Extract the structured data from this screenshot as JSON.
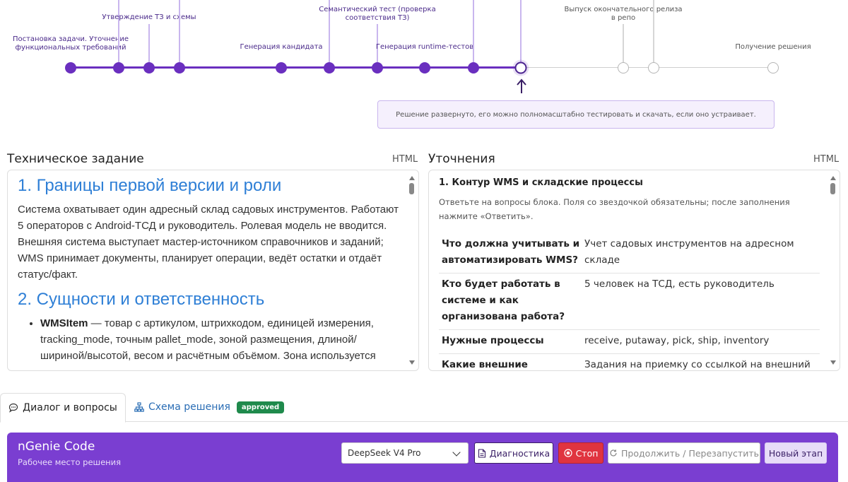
{
  "timeline": {
    "stages": [
      {
        "label": "Постановка задачи. Уточнение\nфункциональных требований",
        "status": "done"
      },
      {
        "label": "",
        "status": "done"
      },
      {
        "label": "Утверждение ТЗ и схемы",
        "status": "done"
      },
      {
        "label": "",
        "status": "done"
      },
      {
        "label": "Генерация кандидата",
        "status": "done"
      },
      {
        "label": "",
        "status": "done"
      },
      {
        "label": "Семантический тест (проверка\nсоответствия ТЗ)",
        "status": "done"
      },
      {
        "label": "Генерация runtime-тестов",
        "status": "done"
      },
      {
        "label": "",
        "status": "done"
      },
      {
        "label": "",
        "status": "current"
      },
      {
        "label": "Выпуск окончательного релиза\nв репо",
        "status": "todo"
      },
      {
        "label": "",
        "status": "todo"
      },
      {
        "label": "Получение решения",
        "status": "todo"
      }
    ],
    "current_info": "Решение развернуто, его можно полномасштабно тестировать и скачать, если оно устраивает."
  },
  "spec_panel": {
    "title": "Техническое задание",
    "mode": "HTML",
    "heading1": "1. Границы первой версии и роли",
    "paragraph1": "Система охватывает один адресный склад садовых инструментов. Работают 5 операторов с Android-ТСД и руководитель. Ролевая модель не вводится. Внешняя система выступает мастер-источником справочников и заданий; WMS принимает документы, планирует операции, ведёт остатки и отдаёт статус/факт.",
    "heading2": "2. Сущности и ответственность",
    "bullet1_term": "WMSItem",
    "bullet1_text": " — товар с артикулом, штрихкодом, единицей измерения, tracking_mode, точным pallet_mode, зоной размещения, длиной/шириной/высотой, весом и расчётным объёмом. Зона используется"
  },
  "clar_panel": {
    "title": "Уточнения",
    "mode": "HTML",
    "block_title": "1. Контур WMS и складские процессы",
    "hint": "Ответьте на вопросы блока. Поля со звездочкой обязательны; после заполнения нажмите «Ответить».",
    "rows": [
      {
        "q": "Что должна учитывать и автоматизировать WMS?",
        "a": "Учет садовых инструментов на адресном складе"
      },
      {
        "q": "Кто будет работать в системе и как организована работа?",
        "a": "5 человек на ТСД, есть руководитель"
      },
      {
        "q": "Нужные процессы",
        "a": "receive, putaway, pick, ship, inventory"
      },
      {
        "q": "Какие внешние",
        "a": "Задания на приемку со ссылкой на внешний"
      }
    ]
  },
  "tabs": {
    "dialog_icon": "speech-bubble-icon",
    "dialog_label": "Диалог и вопросы",
    "scheme_icon": "tree-diagram-icon",
    "scheme_label": "Схема решения",
    "scheme_badge": "approved"
  },
  "ngenie": {
    "title": "nGenie Code",
    "subtitle": "Рабочее место решения",
    "model": "DeepSeek V4 Pro",
    "diag_label": "Диагностика",
    "stop_label": "Стоп",
    "continue_label": "Продолжить / Перезапустить",
    "new_stage_label": "Новый этап"
  },
  "colors": {
    "accent": "#6a2fbf",
    "header_bg": "#7a3ed1",
    "approved_badge": "#1f8a4c",
    "stop": "#e0343f",
    "heading_blue": "#2e7fd6"
  }
}
